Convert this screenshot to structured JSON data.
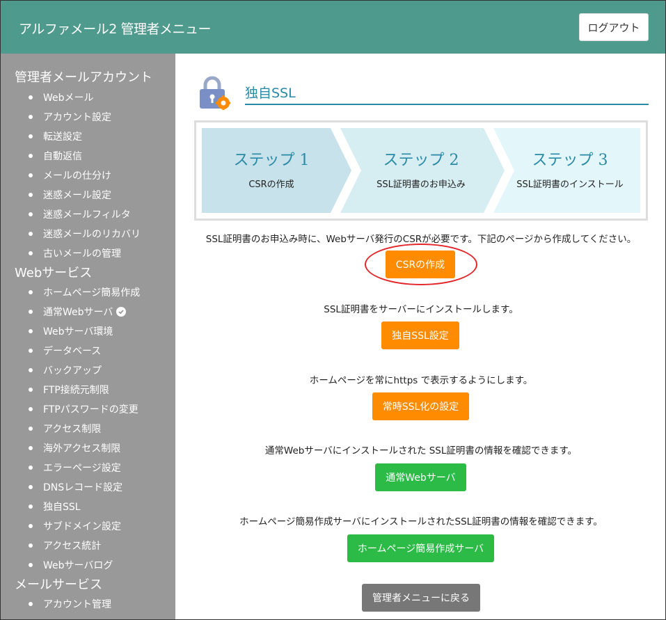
{
  "header": {
    "app_title": "アルファメール2 管理者メニュー",
    "logout_label": "ログアウト"
  },
  "sidebar": {
    "sections": [
      {
        "title": "管理者メールアカウント",
        "items": [
          "Webメール",
          "アカウント設定",
          "転送設定",
          "自動返信",
          "メールの仕分け",
          "迷惑メール設定",
          "迷惑メールフィルタ",
          "迷惑メールのリカバリ",
          "古いメールの管理"
        ]
      },
      {
        "title": "Webサービス",
        "items": [
          "ホームページ簡易作成",
          "通常Webサーバ",
          "Webサーバ環境",
          "データベース",
          "バックアップ",
          "FTP接続元制限",
          "FTPパスワードの変更",
          "アクセス制限",
          "海外アクセス制限",
          "エラーページ設定",
          "DNSレコード設定",
          "独自SSL",
          "サブドメイン設定",
          "アクセス統計",
          "Webサーバログ"
        ]
      },
      {
        "title": "メールサービス",
        "items": [
          "アカウント管理"
        ]
      }
    ]
  },
  "main": {
    "title": "独自SSL",
    "steps": [
      {
        "label": "ステップ 1",
        "sub": "CSRの作成"
      },
      {
        "label": "ステップ 2",
        "sub": "SSL証明書のお申込み"
      },
      {
        "label": "ステップ 3",
        "sub": "SSL証明書のインストール"
      }
    ],
    "sections": [
      {
        "message": "SSL証明書のお申込み時に、Webサーバ発行のCSRが必要です。下記のページから作成してください。",
        "button": "CSRの作成"
      },
      {
        "message": "SSL証明書をサーバーにインストールします。",
        "button": "独自SSL設定"
      },
      {
        "message": "ホームページを常にhttps で表示するようにします。",
        "button": "常時SSL化の設定"
      },
      {
        "message": "通常Webサーバにインストールされた SSL証明書の情報を確認できます。",
        "button": "通常Webサーバ"
      },
      {
        "message": "ホームページ簡易作成サーバにインストールされたSSL証明書の情報を確認できます。",
        "button": "ホームページ簡易作成サーバ"
      }
    ],
    "back_button": "管理者メニューに戻る"
  },
  "colors": {
    "header_bg": "#4e9a8c",
    "sidebar_bg": "#999999",
    "accent": "#2a8aa6",
    "orange": "#ff8b00",
    "green": "#2dbb47",
    "gray_button": "#777777",
    "highlight": "#e3262a"
  }
}
